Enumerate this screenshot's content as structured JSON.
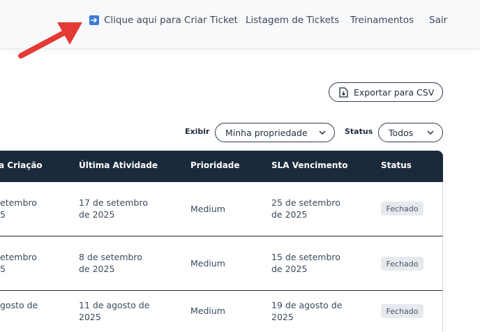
{
  "nav": {
    "create_ticket": "Clique aqui para Criar Ticket",
    "list_tickets": "Listagem de Tickets",
    "trainings": "Treinamentos",
    "exit": "Sair"
  },
  "toolbar": {
    "export_label": "Exportar para CSV"
  },
  "filters": {
    "exibir_label": "Exibir",
    "exibir_value": "Minha propriedade",
    "status_label": "Status",
    "status_value": "Todos"
  },
  "table": {
    "headers": [
      "a Criação",
      "Última Atividade",
      "Prioridade",
      "SLA Vencimento",
      "Status"
    ],
    "rows": [
      {
        "created_1": "etembro",
        "created_2": "5",
        "activity_1": "17 de setembro",
        "activity_2": "de 2025",
        "priority": "Medium",
        "sla_1": "25 de setembro",
        "sla_2": "de 2025",
        "status": "Fechado"
      },
      {
        "created_1": "etembro",
        "created_2": "5",
        "activity_1": "8 de setembro",
        "activity_2": "de 2025",
        "priority": "Medium",
        "sla_1": "15 de setembro",
        "sla_2": "de 2025",
        "status": "Fechado"
      },
      {
        "created_1": "gosto de",
        "created_2": "",
        "activity_1": "11 de agosto de",
        "activity_2": "2025",
        "priority": "Medium",
        "sla_1": "19 de agosto de",
        "sla_2": "2025",
        "status": "Fechado"
      }
    ]
  },
  "colors": {
    "header_bg": "#1b2a3a",
    "badge_bg": "#e6e9ed",
    "arrow": "#e53935",
    "create_icon": "#3d7ad6"
  }
}
